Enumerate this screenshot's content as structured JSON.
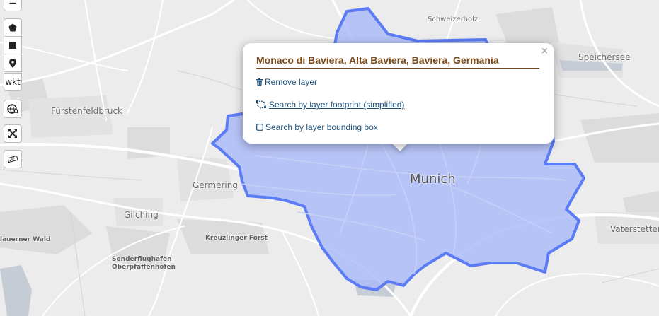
{
  "map": {
    "places": {
      "schweizerholz": "Schweizerholz",
      "speichersee": "Speichersee",
      "fuerstenfeldbruck": "Fürstenfeldbruck",
      "germering": "Germering",
      "munich": "Munich",
      "gilching": "Gilching",
      "kreuzlinger_forst": "Kreuzlinger Forst",
      "lauerner_wald": "lauerner Wald",
      "sonderflughafen": "Sonderflughafen",
      "oberpfaffenhofen": "Oberpfaffenhofen",
      "vaterstetten": "Vaterstetten"
    },
    "boundary_color": "#5c7cf5",
    "boundary_fill": "#a9b9f8"
  },
  "toolbar": {
    "zoom_out_label": "−",
    "wkt_label": "wkt",
    "icons": [
      "polygon-icon",
      "rectangle-icon",
      "marker-icon",
      "globe-search-icon",
      "fullscreen-icon",
      "ruler-icon"
    ]
  },
  "popup": {
    "title": "Monaco di Baviera, Alta Baviera, Baviera, Germania",
    "close": "×",
    "remove_layer": "Remove layer",
    "search_footprint": "Search by layer footprint (simplified)",
    "search_bbox": "Search by layer bounding box"
  }
}
